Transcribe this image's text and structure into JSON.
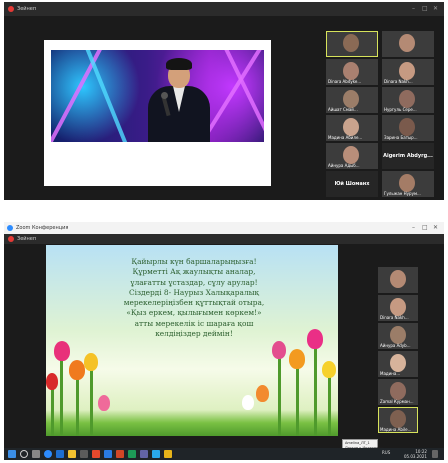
{
  "top_window": {
    "title": "Зейнеп",
    "window_controls": [
      "–",
      "□",
      "✕"
    ],
    "participants": [
      {
        "label": ""
      },
      {
        "label": ""
      },
      {
        "label": "Dinara Abdyke..."
      },
      {
        "label": "Dinara Nakh..."
      },
      {
        "label": "Айшат Смай..."
      },
      {
        "label": "Нургуль Сере..."
      },
      {
        "label": "Мадина Абиле..."
      },
      {
        "label": "Зарина Батыр..."
      },
      {
        "label": "Айнура Адыб..."
      },
      {
        "label": "Aigerim Abdyrg..."
      },
      {
        "label": "Юй Шоманх"
      },
      {
        "label": "Гульжан Нурум..."
      }
    ]
  },
  "bottom_window": {
    "app_title": "Zoom Конференция",
    "window_controls": [
      "–",
      "□",
      "✕"
    ],
    "presenter_label": "Зейнеп",
    "slide_lines": [
      "Қайырлы күн баршаларыңызға!",
      "Құрметті Ақ жаулықты аналар,",
      "ұлағатты ұстаздар, сұлу арулар!",
      "Сіздерді 8- Наурыз Халықаралық",
      "мерекелеріңізбен құттықтай отыра,",
      "«Қыз еркем, қылығымен көркем!»",
      "атты мерекелік іс шараға қош",
      "келдіңіздер деймін!"
    ],
    "participants": [
      {
        "label": ""
      },
      {
        "label": "Dinara Nakh..."
      },
      {
        "label": "Айнура Adyb..."
      },
      {
        "label": "Мадина..."
      },
      {
        "label": "Zamal Курман..."
      },
      {
        "label": "Мадина Abile..."
      }
    ],
    "tooltip": {
      "line1": "Amelina_ЛТ_1",
      "line2": "Доступ к Интернету"
    },
    "taskbar": {
      "search_placeholder": "",
      "time": "10:22",
      "date": "05.03.2021",
      "lang": "RUS"
    }
  },
  "colors": {
    "window_bg": "#1b1b1b",
    "active_speaker": "#d7e35b",
    "slide_text": "#2e6130"
  }
}
